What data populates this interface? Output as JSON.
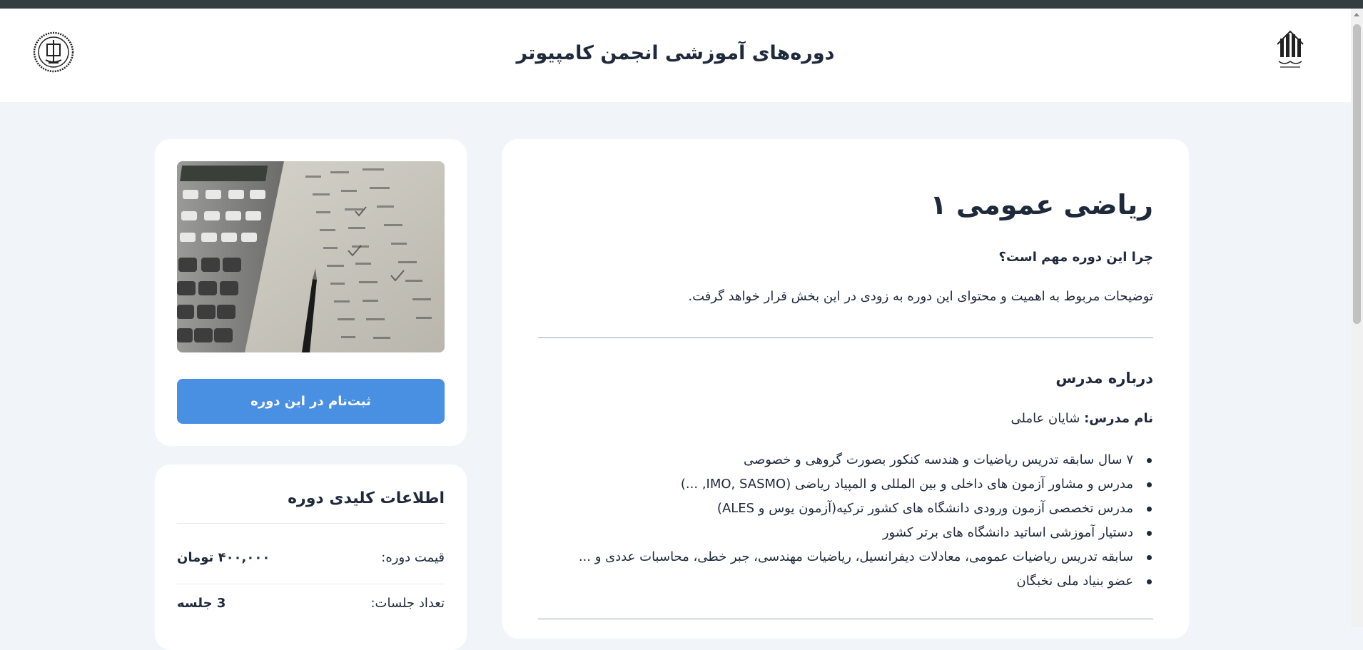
{
  "header": {
    "title": "دوره‌های آموزشی انجمن کامپیوتر",
    "left_logo": "university-seal-icon",
    "right_logo": "university-logo-icon"
  },
  "course": {
    "title": "ریاضی عمومی ۱",
    "why_heading": "چرا این دوره مهم است؟",
    "why_text": "توضیحات مربوط به اهمیت و محتوای این دوره به زودی در این بخش قرار خواهد گرفت.",
    "about_heading": "درباره مدرس",
    "instructor_label": "نام مدرس:",
    "instructor_name": "شایان عاملی",
    "bullets": [
      "۷ سال سابقه تدریس ریاضیات و هندسه کنکور بصورت گروهی و خصوصی",
      "مدرس و مشاور آزمون های داخلی و بین المللی و المپیاد ریاضی (IMO, SASMO, ...)",
      "مدرس تخصصی آزمون ورودی دانشگاه های کشور ترکیه(آزمون یوس و ALES)",
      "دستیار آموزشی اساتید دانشگاه های برتر کشور",
      "سابقه تدریس ریاضیات عمومی، معادلات دیفرانسیل، ریاضیات مهندسی، جبر خطی، محاسبات عددی و ...",
      "عضو بنیاد ملی نخبگان"
    ]
  },
  "sidebar": {
    "image_alt": "calculator-and-pen-image",
    "enroll_label": "ثبت‌نام در این دوره",
    "info_title": "اطلاعات کلیدی دوره",
    "rows": [
      {
        "label": "قیمت دوره:",
        "value": "۴۰۰,۰۰۰ تومان"
      },
      {
        "label": "تعداد جلسات:",
        "value": "3 جلسه"
      }
    ]
  },
  "colors": {
    "accent": "#4a90e2",
    "background": "#f1f5f9",
    "text": "#1e293b"
  }
}
